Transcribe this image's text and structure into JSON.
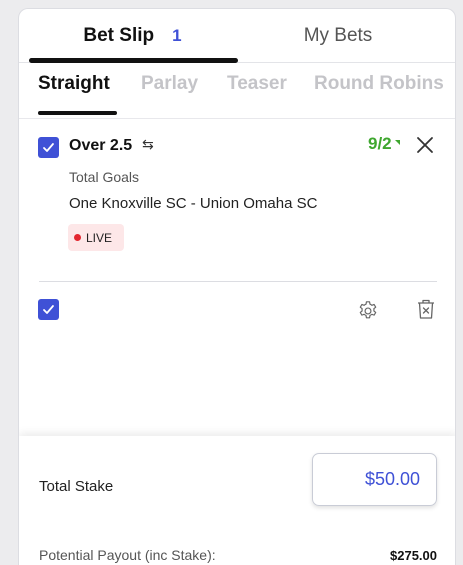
{
  "header": {
    "tabs": [
      {
        "label": "Bet Slip",
        "count": "1",
        "active": true
      },
      {
        "label": "My Bets",
        "active": false
      }
    ]
  },
  "bet_types": [
    {
      "label": "Straight",
      "active": true
    },
    {
      "label": "Parlay",
      "active": false
    },
    {
      "label": "Teaser",
      "active": false
    },
    {
      "label": "Round Robins",
      "active": false
    }
  ],
  "selection": {
    "title": "Over 2.5",
    "swap_icon": "swap-arrows-icon",
    "odds": "9/2",
    "market": "Total Goals",
    "event": "One Knoxville SC - Union Omaha SC",
    "status": "LIVE",
    "checked": true
  },
  "slip_actions": {
    "select_all_checked": true,
    "settings_icon": "gear-icon",
    "clear_icon": "trash-icon"
  },
  "footer": {
    "total_stake_label": "Total Stake",
    "total_stake_value": "$50.00",
    "payout_label": "Potential Payout (inc Stake):",
    "payout_value": "$275.00"
  },
  "colors": {
    "accent": "#3f51d6",
    "odds": "#3fa72f",
    "live_dot": "#e3262f",
    "live_bg": "#fde7e8"
  }
}
